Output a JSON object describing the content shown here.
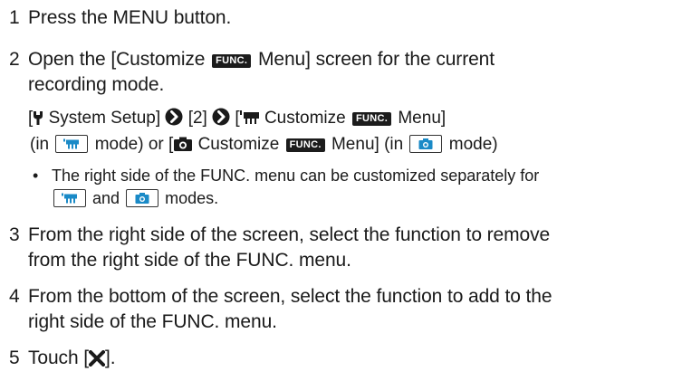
{
  "steps": [
    {
      "num": "1",
      "text": "Press the MENU button."
    },
    {
      "num": "2",
      "pre": "Open the [Customize",
      "badge": "FUNC.",
      "post_line1": "Menu] screen for the current",
      "line2": "recording mode."
    },
    {
      "num": "3",
      "line1": "From the right side of the screen, select the function to remove",
      "line2": "from the right side of the FUNC. menu."
    },
    {
      "num": "4",
      "line1": "From the bottom of the screen, select the function to add to the",
      "line2": "right side of the FUNC. menu."
    },
    {
      "num": "5",
      "pre": "Touch [",
      "post": "]."
    }
  ],
  "menu_path": {
    "open_bracket": "[",
    "system_setup": "System Setup]",
    "page_num": "[2]",
    "open_bracket2": "[",
    "customize": "Customize",
    "badge": "FUNC.",
    "menu_close": "Menu]",
    "in_open": "(in",
    "mode_or": "mode) or [",
    "customize2": "Customize",
    "badge2": "FUNC.",
    "menu_close2": "Menu] (in",
    "mode_close": "mode)"
  },
  "bullet": {
    "symbol": "•",
    "line1": "The right side of the FUNC. menu can be customized separately for",
    "and": "and",
    "modes": "modes."
  },
  "icons": {
    "arrow": "right-arrow-icon",
    "wrench": "wrench-icon",
    "movie": "movie-camera-icon",
    "camera": "still-camera-icon",
    "close": "close-x-icon"
  }
}
